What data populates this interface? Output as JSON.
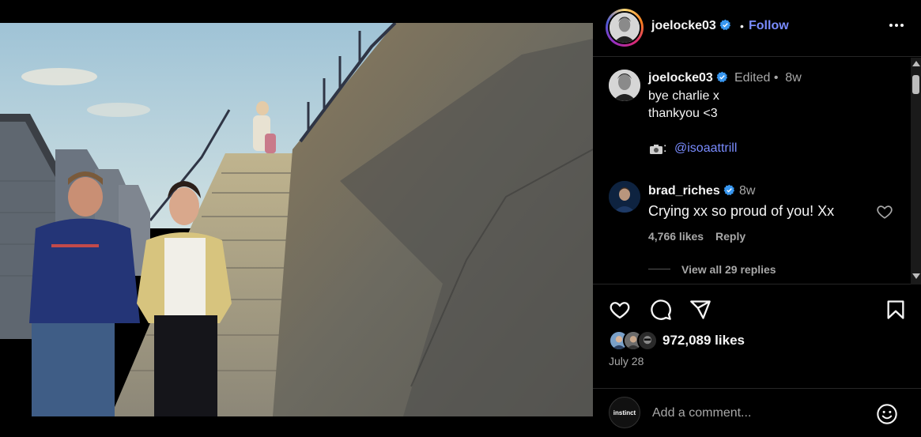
{
  "header": {
    "username": "joelocke03",
    "separator": "•",
    "follow_label": "Follow"
  },
  "caption": {
    "username": "joelocke03",
    "meta": "Edited •  8w",
    "line1": "bye charlie x",
    "line2": "thankyou <3",
    "mention_prefix": ":",
    "mention": "@isoaattrill"
  },
  "comment": {
    "username": "brad_riches",
    "time": "8w",
    "text": "Crying xx so proud of you! Xx",
    "likes": "4,766 likes",
    "reply_label": "Reply",
    "view_replies": "View all 29 replies"
  },
  "post": {
    "likes": "972,089 likes",
    "date": "July 28"
  },
  "comment_bar": {
    "avatar_text": "instinct",
    "placeholder": "Add a comment..."
  },
  "icons": {
    "verified": "verified-badge-icon",
    "more": "more-options-icon",
    "heart": "heart-icon",
    "comment": "comment-icon",
    "share": "share-icon",
    "bookmark": "bookmark-icon",
    "emoji": "emoji-icon",
    "camera": "camera-icon"
  },
  "colors": {
    "accent": "#7a8cff",
    "verified": "#3897f0",
    "muted": "#a8a8a8",
    "background": "#000000"
  }
}
